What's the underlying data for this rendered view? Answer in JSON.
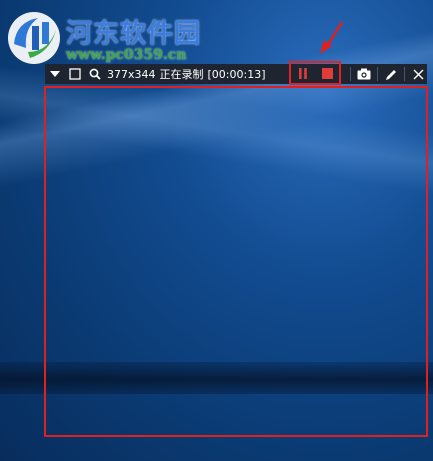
{
  "watermark": {
    "title": "河东软件园",
    "url": "www.pc0359.cn"
  },
  "toolbar": {
    "dimensions": "377x344",
    "status": "正在录制",
    "timer": "[00:00:13]",
    "icons": [
      "dropdown-arrow-icon",
      "window-icon",
      "search-icon",
      "pause-icon",
      "stop-icon",
      "camera-icon",
      "pencil-icon",
      "close-icon"
    ]
  },
  "colors": {
    "toolbar_bg": "#1e2430",
    "highlight_red": "#e21f1f",
    "record_red": "#e03c3c",
    "watermark_blue": "#3a7ce0",
    "watermark_green": "#3ca847"
  }
}
